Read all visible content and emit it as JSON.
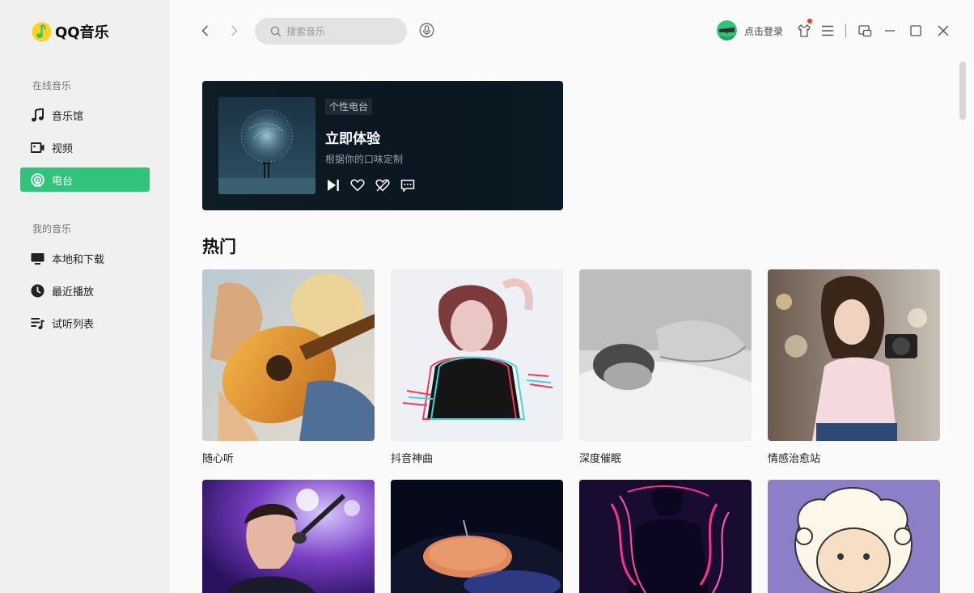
{
  "app": {
    "name": "QQ音乐"
  },
  "sidebar": {
    "online_title": "在线音乐",
    "my_title": "我的音乐",
    "online_items": [
      {
        "label": "音乐馆",
        "icon": "music-note-icon"
      },
      {
        "label": "视频",
        "icon": "video-icon"
      },
      {
        "label": "电台",
        "icon": "radio-icon",
        "active": true
      }
    ],
    "my_items": [
      {
        "label": "本地和下载",
        "icon": "monitor-icon"
      },
      {
        "label": "最近播放",
        "icon": "clock-icon"
      },
      {
        "label": "试听列表",
        "icon": "playlist-icon"
      }
    ]
  },
  "topbar": {
    "search_placeholder": "搜索音乐",
    "login_label": "点击登录"
  },
  "radio": {
    "tag": "个性电台",
    "title": "立即体验",
    "subtitle": "根据你的口味定制"
  },
  "hot": {
    "heading": "热门",
    "tiles": [
      {
        "label": "随心听"
      },
      {
        "label": "抖音神曲"
      },
      {
        "label": "深度催眠"
      },
      {
        "label": "情感治愈站"
      }
    ]
  },
  "colors": {
    "accent": "#31c27c",
    "notification": "#e83b2f"
  }
}
